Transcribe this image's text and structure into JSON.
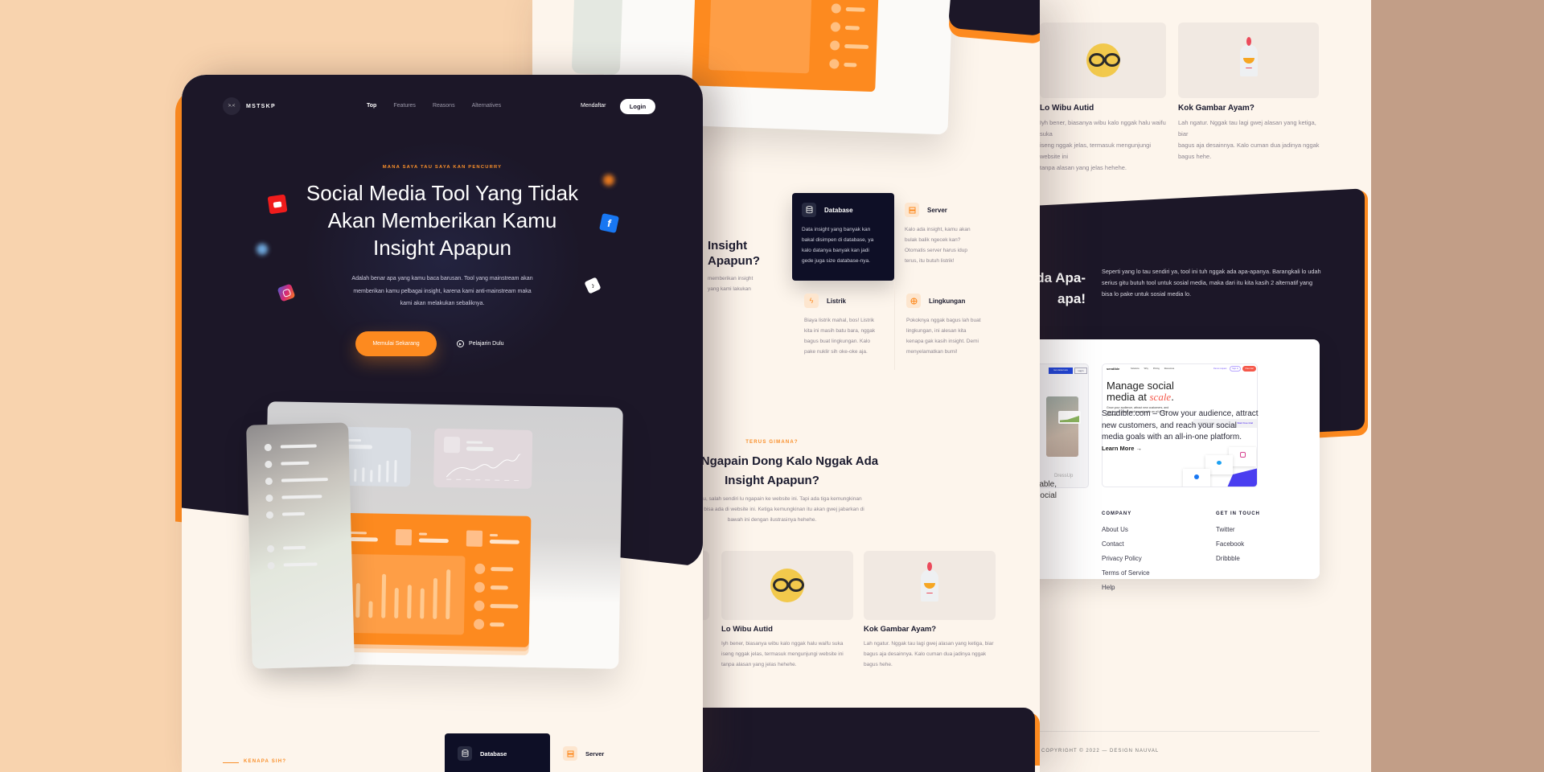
{
  "front": {
    "nav": {
      "logo_mark": ">.<",
      "logo": "MSTSKP",
      "items": [
        "Top",
        "Features",
        "Reasons",
        "Alternatives"
      ],
      "signup": "Mendaftar",
      "login": "Login"
    },
    "hero": {
      "eyebrow": "MANA SAYA TAU SAYA KAN PENCURRY",
      "title_lines": [
        "Social Media Tool Yang Tidak",
        "Akan Memberikan Kamu",
        "Insight Apapun"
      ],
      "desc_lines": [
        "Adalah benar apa yang kamu baca barusan. Tool yang mainstream akan",
        "memberikan kamu pelbagai insight, karena kami anti-mainstream maka",
        "kami akan melakukan sebaliknya."
      ],
      "cta_primary": "Memulai Sekarang",
      "cta_secondary": "Pelajarin Dulu"
    },
    "next": {
      "eyebrow": "KENAPA SIH?",
      "features": [
        "Database",
        "Server"
      ]
    }
  },
  "middle": {
    "reasons": {
      "heading": "Insight Apapun?",
      "desc_lines": [
        "memberikan insight",
        "yang kami lakukan"
      ]
    },
    "features": [
      {
        "title": "Database",
        "lines": [
          "Data insight yang banyak kan",
          "bakal disimpen di database, ya",
          "kalo datanya banyak kan jadi",
          "gede juga size database-nya."
        ]
      },
      {
        "title": "Server",
        "lines": [
          "Kalo ada insight, kamu akan",
          "bulak balik ngecek kan?",
          "Otomatis server harus idup",
          "terus, itu butuh listrik!"
        ]
      },
      {
        "title": "Listrik",
        "lines": [
          "Biaya listrik mahal, bos! Listrik",
          "kita ini masih batu bara, nggak",
          "bagus buat lingkungan. Kalo",
          "pake nuklir sih oke-oke aja."
        ]
      },
      {
        "title": "Lingkungan",
        "lines": [
          "Pokoknya nggak bagus lah buat",
          "lingkungan, ini alesan kita",
          "kenapa gak kasih insight. Demi",
          "menyelamatkan bumi!"
        ]
      }
    ],
    "section2": {
      "eyebrow": "TERUS GIMANA?",
      "title_lines": [
        "Terus Ngapain Dong Kalo Nggak Ada",
        "Insight Apapun?"
      ],
      "desc_lines": [
        "Nggak tau, salah sendiri lu ngapain ke website ini. Tapi ada tiga kemungkinan",
        "kenapa lo bisa ada di website ini. Ketiga kemungkinan itu akan gwej jabarkan di",
        "bawah ini dengan ilustrasinya hehehe."
      ]
    },
    "cards": [
      {
        "title": "Lo Wibu Autid",
        "lines": [
          "Iyh bener, biasanya wibu kalo nggak halu waifu suka",
          "iseng nggak jelas, termasuk mengunjungi website ini",
          "tanpa alasan yang jelas hehehe."
        ]
      },
      {
        "title": "Kok Gambar Ayam?",
        "lines": [
          "Lah ngatur. Nggak tau lagi gwej alasan yang ketiga, biar",
          "bagus aja desainnya. Kalo cuman dua jadinya nggak",
          "bagus hehe."
        ]
      }
    ]
  },
  "right": {
    "cards": [
      {
        "title": "Lo Wibu Autid",
        "lines": [
          "Iyh bener, biasanya wibu kalo nggak halu waifu suka",
          "iseng nggak jelas, termasuk mengunjungi website ini",
          "tanpa alasan yang jelas hehehe."
        ]
      },
      {
        "title": "Kok Gambar Ayam?",
        "lines": [
          "Lah ngatur. Nggak tau lagi gwej alasan yang ketiga, biar",
          "bagus aja desainnya. Kalo cuman dua jadinya nggak",
          "bagus hehe."
        ]
      }
    ],
    "alternatives": {
      "heading_lines": [
        "Nggak Ada Apa-",
        "apa!"
      ],
      "desc_lines": [
        "Seperti yang lo tau sendiri ya, tool ini tuh nggak ada apa-apanya. Barangkali lo udah",
        "serius gitu butuh tool untuk sosial media, maka dari itu kita kasih 2 alternatif yang",
        "bisa lo pake untuk sosial media lo."
      ],
      "dressup": {
        "name": "DressUp",
        "get_started": "Get started now",
        "login": "Log in",
        "desc_lines": [
          "affordable,",
          "on social"
        ]
      },
      "sendible": {
        "logo": "sendible",
        "nav": [
          "Solutions",
          "Why",
          "Pricing",
          "Resources"
        ],
        "demo": "Demo request",
        "signin": "Sign in",
        "trial": "Free trial",
        "headline_a": "Manage social",
        "headline_b": "media at ",
        "headline_c": "scale",
        "sub": "Grow your audience, attract new customers, and reach your social media goals with an all-in-one platform.",
        "email_placeholder": "your work email",
        "start": "Start free trial",
        "desc": "Sendible.com – Grow your audience, attract new customers, and reach your social media goals with an all-in-one platform.",
        "learn_more": "Learn More"
      }
    },
    "footer": {
      "company_title": "COMPANY",
      "company_links": [
        "About Us",
        "Contact",
        "Privacy Policy",
        "Terms of Service",
        "Help"
      ],
      "contact_title": "GET IN TOUCH",
      "contact_links": [
        "Twitter",
        "Facebook",
        "Dribbble"
      ],
      "copyright": "COPYRIGHT © 2022 — DESIGN NAUVAL"
    }
  }
}
